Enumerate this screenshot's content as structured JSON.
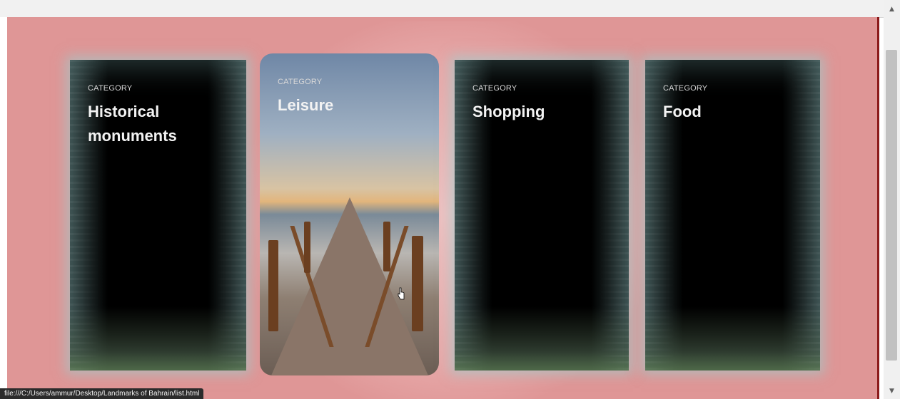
{
  "page": {
    "background_color": "#df9696",
    "accent_border_color": "#8b1a1a"
  },
  "cards": [
    {
      "category": "CATEGORY",
      "title": "Historical monuments"
    },
    {
      "category": "CATEGORY",
      "title": "Leisure"
    },
    {
      "category": "CATEGORY",
      "title": "Shopping"
    },
    {
      "category": "CATEGORY",
      "title": "Food"
    }
  ],
  "statusbar": {
    "url": "file:///C:/Users/ammur/Desktop/Landmarks of Bahrain/list.html"
  },
  "icons": {
    "scroll_up": "scroll-up-arrow",
    "scroll_down": "scroll-down-arrow",
    "cursor": "hand-pointer"
  }
}
